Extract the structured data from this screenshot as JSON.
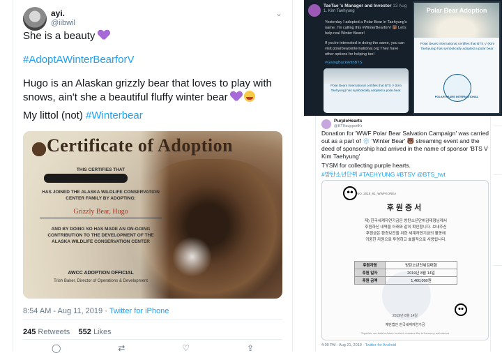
{
  "left_tweet": {
    "display_name": "ayi.",
    "handle": "@iibwil",
    "line1": "She is a beauty",
    "hashtag1": "#AdoptAWinterBearforV",
    "para_part1": "Hugo is an Alaskan grizzly bear that loves to play with snows, ain't she a beautiful fluffy winter bear",
    "line3_prefix": "My littol (not)",
    "hashtag2": "#Winterbear",
    "timestamp": "8:54 AM - Aug 11, 2019",
    "source_sep": " · ",
    "source": "Twitter for iPhone",
    "retweets_count": "245",
    "retweets_label": "Retweets",
    "likes_count": "552",
    "likes_label": "Likes",
    "icons": [
      "heart-purple-icon",
      "smiling-face-hearts-icon",
      "chevron-down-icon",
      "reply-icon",
      "retweet-icon",
      "like-icon",
      "share-icon"
    ]
  },
  "certificate": {
    "title": "Certificate of Adoption",
    "certify": "THIS CERTIFIES THAT",
    "joined": "HAS JOINED THE ALASKA WILDLIFE CONSERVATION CENTER FAMILY BY ADOPTING:",
    "sponsor": "Grizzly Bear, Hugo",
    "contrib": "AND BY DOING SO HAS MADE AN ON-GOING CONTRIBUTION TO THE DEVELOPMENT OF THE ALASKA WILDLIFE CONSERVATION CENTER",
    "official": "AWCC ADOPTION OFFICIAL",
    "signer": "Trish Baker, Director of Operations & Development"
  },
  "top_right": {
    "name": "TaeTae 's Manager and Investor",
    "date": "13 Aug",
    "sub": "1. Kim Taehyung",
    "p1": "Yesterday I adopted a Polar Bear in Taehyung's name. I'm calling this #WinterBearforV 🐻 Let's help real Winter Bears!",
    "p2": "If you're interested in doing the same, you can visit polarbearsinternational.org They have other options for helping too!",
    "hashtag": "#GivingBackWithBTS",
    "card_text": "Polar Bears International certifies that BTS V (Kim Taehyung) has symbolically adopted a polar bear.",
    "card_title": "Polar Bear Adoption",
    "card_body": "Polar Bears International certifies that BTS V (Kim Taehyung) has symbolically adopted a polar bear.",
    "card_logo": "POLAR BEARS INTERNATIONAL"
  },
  "bottom_right": {
    "name": "PurpleHearts",
    "handle": "@KTHsupportKr",
    "p1": "Donation for 'WWF Polar Bear Salvation Campaign' was carried out as a part of ❄️ 'Winter Bear' 🐻 streaming event and the deed of sponsorship had arrived in the name of sponsor 'BTS V Kim Taehyung'",
    "p2": "TYSM for collecting purple hearts.",
    "hashtags": "#방탄소년단뷔 #TAEHYUNG #BTSV @BTS_twt",
    "doc_no": "NO. 2019_91_WWFKOREA",
    "doc_title": "후원증서",
    "doc_body": "재) 한국세계자연기금은 방탄소년단뷔김태형님께서 후원하신 내역을 아래와 같이 확인합니다. 보내주신 후원금은 환경보전을 위한 세계자연기금의 활동에 귀중한 자원으로 투명하고 효율적으로 사용됩니다.",
    "rows": [
      {
        "k": "후원자명",
        "v": "방탄소년단뷔김태형"
      },
      {
        "k": "후원 일자",
        "v": "2019년 8월 14일"
      },
      {
        "k": "후원 금액",
        "v": "1,460,000원"
      }
    ],
    "doc_date": "2019년 8월 14일",
    "doc_org": "재단법인 한국세계자연기금",
    "doc_eng": "Together, we build a future in which humans live in harmony with nature",
    "timestamp": "4:09 PM - Aug 21, 2019",
    "source": "Twitter for Android"
  }
}
